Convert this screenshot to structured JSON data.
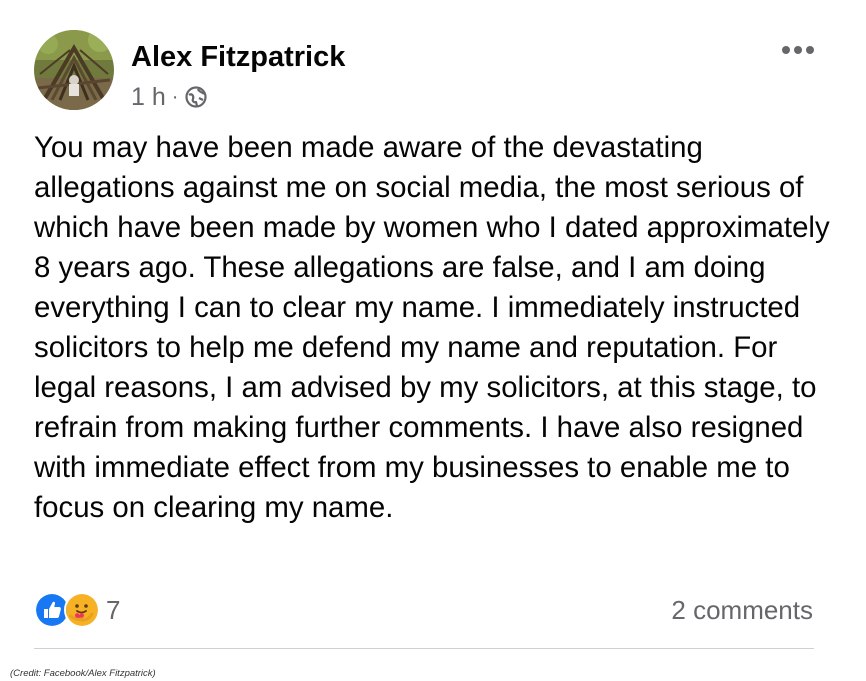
{
  "post": {
    "author": "Alex Fitzpatrick",
    "timestamp": "1 h",
    "separator": "·",
    "audience_icon": "globe-icon",
    "more_icon": "more-options-icon",
    "text": "You may have been made aware of the devastating allegations against me on social media, the most serious of which have been made by women who I dated approximately 8 years ago. These allegations are false, and I am doing everything I can to clear my name. I immediately instructed solicitors to help me defend my name and reputation. For legal reasons, I am advised by my solicitors, at this stage, to refrain from making further comments. I have also resigned with immediate effect from my businesses to enable me to focus on clearing my name."
  },
  "reactions": {
    "icons": [
      "like-icon",
      "care-icon"
    ],
    "count": "7"
  },
  "comments": {
    "label": "2 comments"
  },
  "credit": "(Credit: Facebook/Alex Fitzpatrick)",
  "colors": {
    "like_blue": "#1877f2",
    "secondary_text": "#65676b",
    "primary_text": "#050505",
    "divider": "#ced0d4"
  }
}
